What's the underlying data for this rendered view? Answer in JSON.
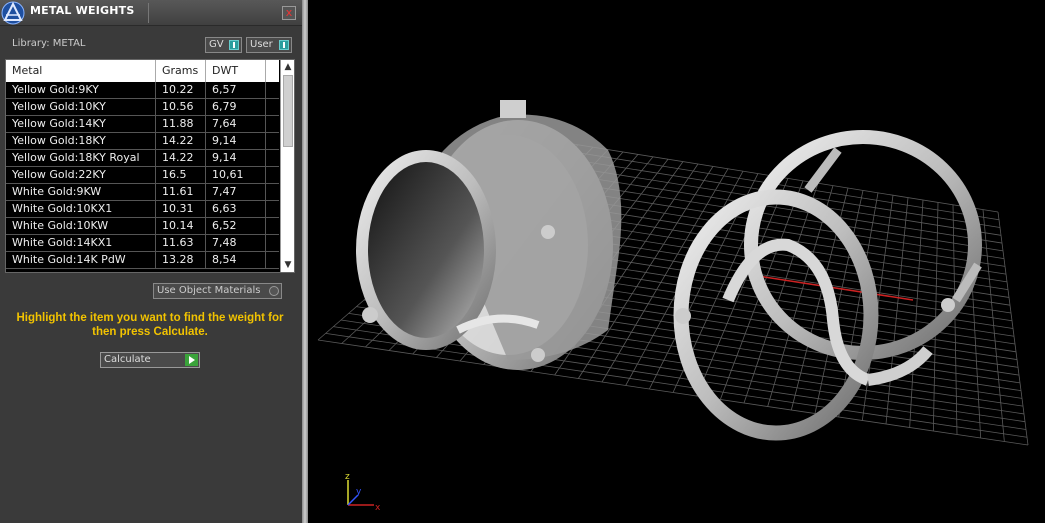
{
  "panel": {
    "title": "METAL WEIGHTS",
    "close_label": "x",
    "library_label": "Library: METAL",
    "toggles": {
      "gv": "GV",
      "user": "User"
    },
    "table": {
      "columns": [
        "Metal",
        "Grams",
        "DWT"
      ],
      "rows": [
        [
          "Yellow Gold:9KY",
          "10.22",
          "6,57"
        ],
        [
          "Yellow Gold:10KY",
          "10.56",
          "6,79"
        ],
        [
          "Yellow Gold:14KY",
          "11.88",
          "7,64"
        ],
        [
          "Yellow Gold:18KY",
          "14.22",
          "9,14"
        ],
        [
          "Yellow Gold:18KY Royal",
          "14.22",
          "9,14"
        ],
        [
          "Yellow Gold:22KY",
          "16.5",
          "10,61"
        ],
        [
          "White Gold:9KW",
          "11.61",
          "7,47"
        ],
        [
          "White Gold:10KX1",
          "10.31",
          "6,63"
        ],
        [
          "White Gold:10KW",
          "10.14",
          "6,52"
        ],
        [
          "White Gold:14KX1",
          "11.63",
          "7,48"
        ],
        [
          "White Gold:14K PdW",
          "13.28",
          "8,54"
        ]
      ]
    },
    "use_object_materials": "Use Object Materials",
    "hint": "Highlight the item you want to find the weight for then press Calculate.",
    "calculate_label": "Calculate"
  },
  "viewport": {
    "axis_labels": {
      "z": "z",
      "y": "y",
      "x": "x"
    }
  },
  "colors": {
    "hint": "#f2c300",
    "led": "#2a9d9d",
    "go": "#3aa33a",
    "axis_x": "#cc2222",
    "axis_y": "#3355ff",
    "axis_z": "#dddd33"
  }
}
